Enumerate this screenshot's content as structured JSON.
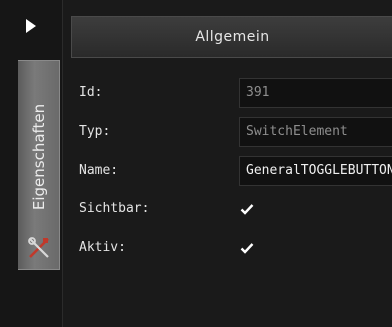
{
  "sidebar": {
    "tab_label": "Eigenschaften",
    "collapse_icon": "triangle-right-icon",
    "tab_icon": "tools-icon"
  },
  "panel": {
    "title": "Allgemein",
    "fields": {
      "id": {
        "label": "Id:",
        "value": "391"
      },
      "typ": {
        "label": "Typ:",
        "value": "SwitchElement"
      },
      "name": {
        "label": "Name:",
        "value": "GeneralTOGGLEBUTTON"
      },
      "sichtbar": {
        "label": "Sichtbar:",
        "checked": true
      },
      "aktiv": {
        "label": "Aktiv:",
        "checked": true
      }
    }
  },
  "colors": {
    "background": "#1b1b1b",
    "tab": "#6e6e6e",
    "accent_red": "#c0392b"
  }
}
